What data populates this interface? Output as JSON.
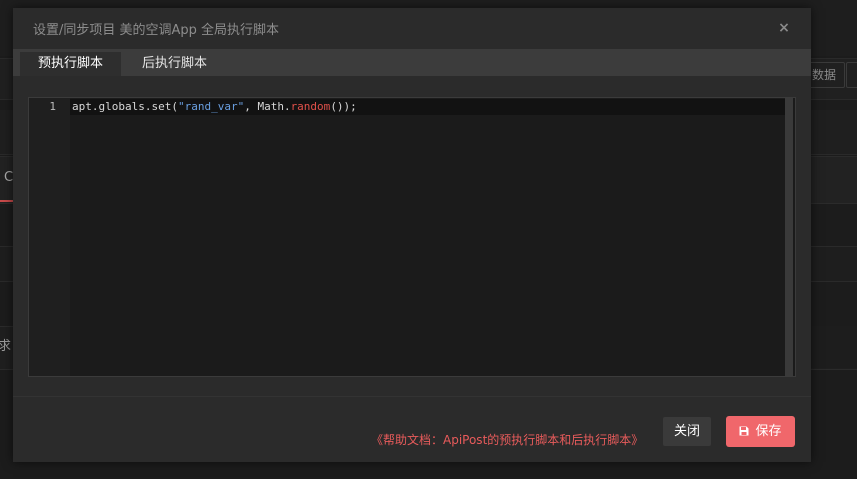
{
  "background": {
    "right_button_label": "数据",
    "left_tab_char": "C",
    "left_row_char": "求"
  },
  "modal": {
    "title": "设置/同步项目 美的空调App 全局执行脚本",
    "close_symbol": "×",
    "tabs": [
      {
        "label": "预执行脚本",
        "active": true
      },
      {
        "label": "后执行脚本",
        "active": false
      }
    ],
    "editor": {
      "line_number": "1",
      "code_parts": [
        {
          "text": "apt.globals.set(",
          "kind": "plain"
        },
        {
          "text": "\"rand_var\"",
          "kind": "string"
        },
        {
          "text": ", Math.",
          "kind": "plain"
        },
        {
          "text": "random",
          "kind": "function"
        },
        {
          "text": "());",
          "kind": "plain"
        }
      ]
    },
    "footer": {
      "help_text": "《帮助文档：ApiPost的预执行脚本和后执行脚本》",
      "close_label": "关闭",
      "save_label": "保存",
      "save_icon": "floppy-disk-icon"
    }
  },
  "colors": {
    "accent": "#f0676b",
    "link": "#e85b5b",
    "code_string": "#6a9fe0",
    "code_function": "#e0504a"
  }
}
